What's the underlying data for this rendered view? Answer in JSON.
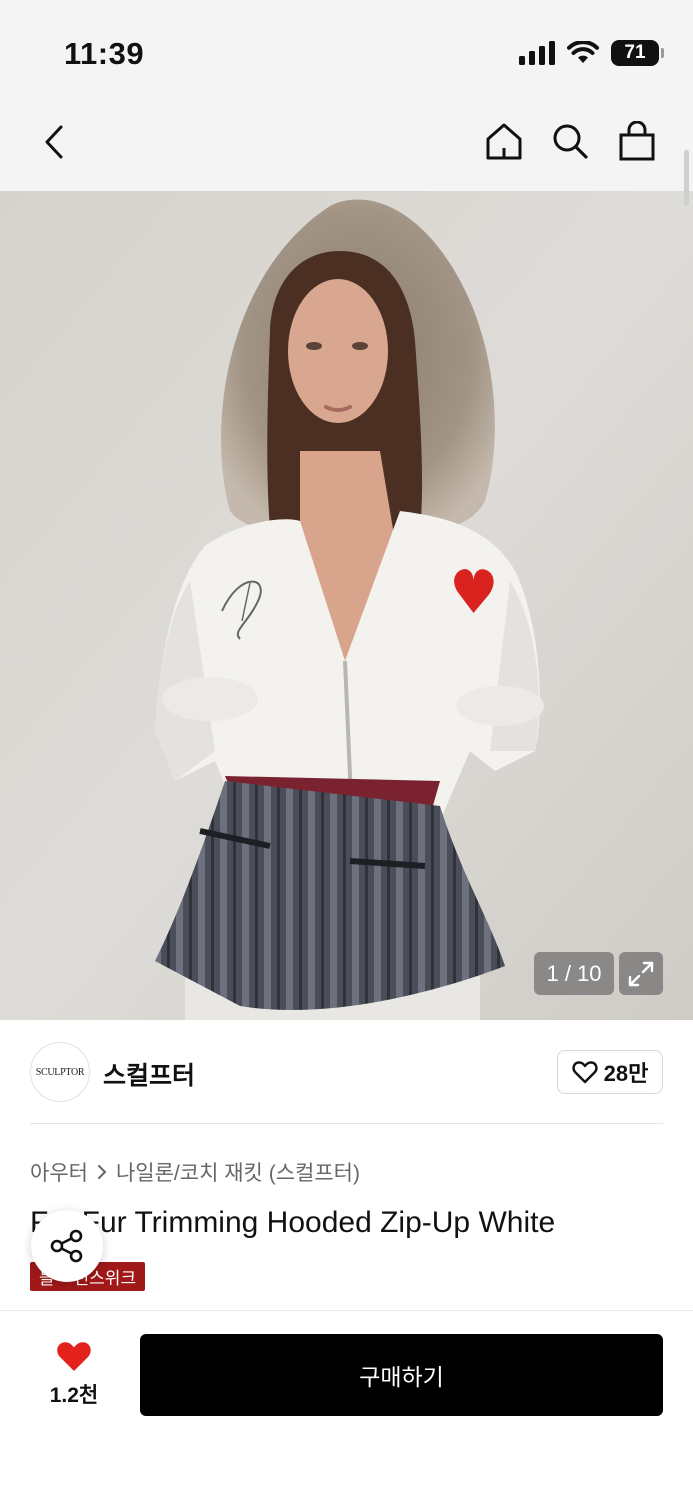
{
  "status_bar": {
    "time": "11:39",
    "battery": "71",
    "icons": [
      "signal-icon",
      "wifi-icon",
      "battery-icon"
    ]
  },
  "nav": {
    "icons": [
      "back-chevron-icon",
      "home-icon",
      "search-icon",
      "shopping-bag-icon"
    ]
  },
  "gallery": {
    "counter": "1 / 10",
    "icons": [
      "expand-icon"
    ]
  },
  "brand": {
    "logo_text": "SCULPTOR",
    "name": "스컬프터",
    "likes": "28만",
    "icons": [
      "heart-outline-icon"
    ]
  },
  "product": {
    "breadcrumb": [
      "아우터",
      "나일론/코치 재킷 (스컬프터)"
    ],
    "title": "F    Fur Trimming Hooded Zip-Up White",
    "badge": "블    런스위크"
  },
  "share": {
    "icons": [
      "share-icon"
    ]
  },
  "bottom_bar": {
    "wish_count": "1.2천",
    "buy_label": "구매하기",
    "icons": [
      "heart-filled-icon"
    ]
  },
  "colors": {
    "header_bg": "#f4f4f4",
    "badge_red": "#a01818",
    "heart_red": "#e3221c",
    "button_black": "#000000"
  }
}
